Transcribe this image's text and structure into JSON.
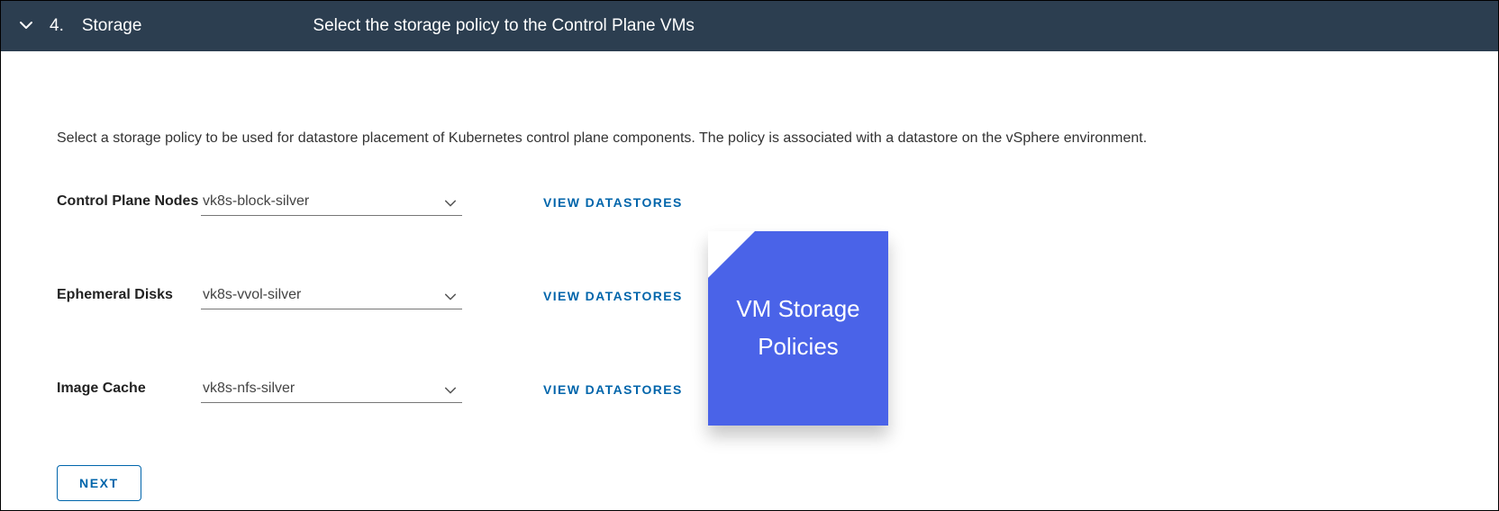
{
  "header": {
    "step_number": "4.",
    "step_title": "Storage",
    "step_description": "Select the storage policy to the Control Plane VMs"
  },
  "description": "Select a storage policy to be used for datastore placement of Kubernetes control plane components. The policy is associated with a datastore on the vSphere environment.",
  "rows": [
    {
      "label": "Control Plane Nodes",
      "value": "vk8s-block-silver",
      "link": "VIEW DATASTORES"
    },
    {
      "label": "Ephemeral Disks",
      "value": "vk8s-vvol-silver",
      "link": "VIEW DATASTORES"
    },
    {
      "label": "Image Cache",
      "value": "vk8s-nfs-silver",
      "link": "VIEW DATASTORES"
    }
  ],
  "next_label": "NEXT",
  "callout_text": "VM Storage Policies"
}
